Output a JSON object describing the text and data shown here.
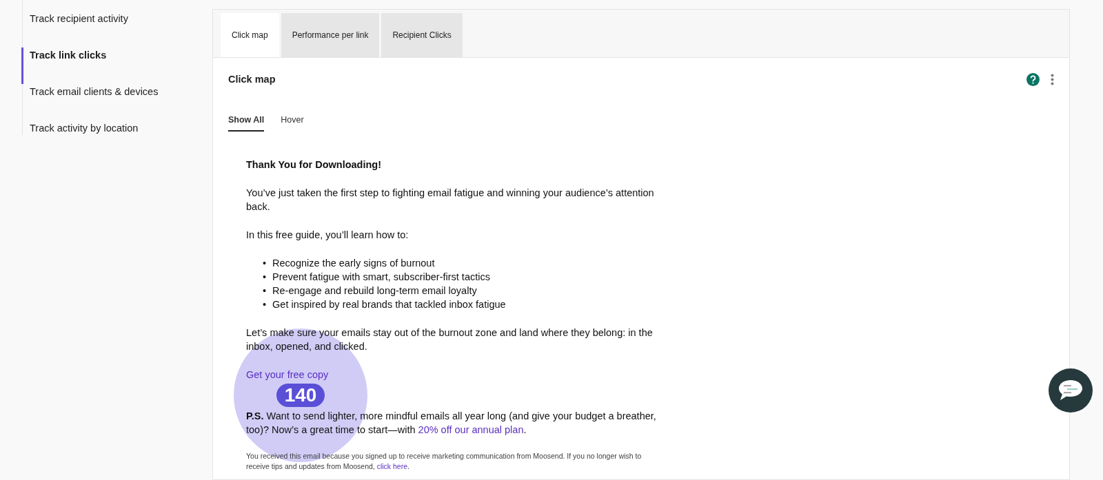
{
  "sidebar": {
    "items": [
      {
        "label": "Track recipient activity",
        "selected": false
      },
      {
        "label": "Track link clicks",
        "selected": true
      },
      {
        "label": "Track email clients & devices",
        "selected": false
      },
      {
        "label": "Track activity by location",
        "selected": false
      }
    ]
  },
  "tabs": [
    {
      "label": "Click map",
      "selected": true
    },
    {
      "label": "Performance per link",
      "selected": false
    },
    {
      "label": "Recipient Clicks",
      "selected": false
    }
  ],
  "panel": {
    "title": "Click map",
    "view_modes": [
      {
        "label": "Show All",
        "selected": true
      },
      {
        "label": "Hover",
        "selected": false
      }
    ]
  },
  "email": {
    "blocks": [
      {
        "kind": "heading",
        "text": "Thank You for Downloading!"
      },
      {
        "kind": "paragraph",
        "text": "You’ve just taken the first step to fighting email fatigue and winning your audience’s attention back."
      },
      {
        "kind": "paragraph",
        "text": "In this free guide, you’ll learn how to:"
      },
      {
        "kind": "list",
        "marker": "•",
        "items": [
          "Recognize the early signs of burnout",
          "Prevent fatigue with smart, subscriber-first tactics",
          "Re-engage and rebuild long-term email loyalty",
          "Get inspired by real brands that tackled inbox fatigue"
        ]
      },
      {
        "kind": "paragraph",
        "text": "Let’s make sure your emails stay out of the burnout zone and land where they belong: in the inbox, opened, and clicked."
      },
      {
        "kind": "link",
        "text": "Get your free copy",
        "click_count": "140"
      },
      {
        "kind": "paragraph",
        "text": "**P.S.** Want to send lighter, more mindful emails all year long (and give your budget a breather, too)? Now’s a great time to start—with ",
        "link": "20% off our annual plan",
        "tail": "."
      },
      {
        "kind": "footer",
        "text": "You received this email because you signed up to receive marketing communication from Moosend. If you no longer wish to receive tips and updates from Moosend, ",
        "link": "click here",
        "tail": "."
      }
    ]
  }
}
